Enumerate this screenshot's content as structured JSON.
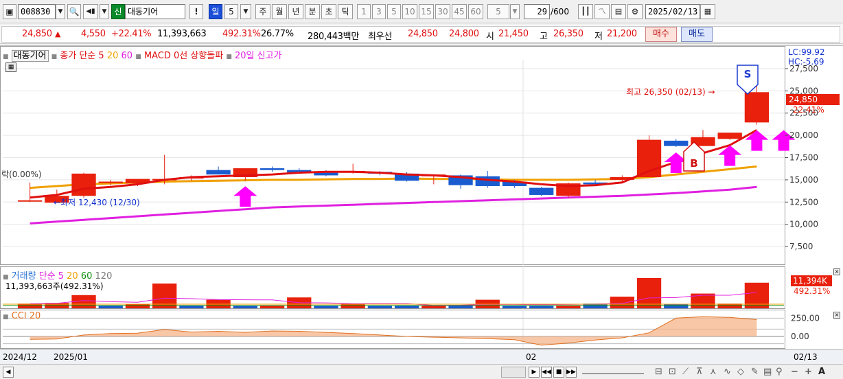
{
  "toolbar": {
    "stock_code": "008830",
    "credit_badge": "신",
    "stock_name": "대동기어",
    "alert": "!",
    "period_day": "일",
    "period_num": "5",
    "period_week": "주",
    "period_month": "월",
    "period_year": "년",
    "period_minute": "분",
    "period_sec": "초",
    "period_tick": "틱",
    "interval_1": "1",
    "interval_3": "3",
    "interval_5": "5",
    "interval_10": "10",
    "interval_15": "15",
    "interval_30": "30",
    "interval_45": "45",
    "interval_60": "60",
    "interval_select": "5",
    "bar_count": "29",
    "bar_total": "/600",
    "date": "2025/02/13"
  },
  "quote": {
    "price": "24,850",
    "change_arrow": "▲",
    "change": "4,550",
    "change_pct": "+22.41%",
    "volume": "11,393,663",
    "volume_ratio": "492.31%",
    "turnover": "26.77%",
    "trade_value": "280,443백만",
    "best_label": "최우선",
    "best_ask": "24,850",
    "best_bid": "24,800",
    "open_label": "시",
    "open": "21,450",
    "high_label": "고",
    "high": "26,350",
    "low_label": "저",
    "low": "21,200",
    "buy_button": "매수",
    "sell_button": "매도"
  },
  "price_pane": {
    "name_tag": "대동기어",
    "legend_close": "종가 단순 5",
    "legend_20": "20",
    "legend_60": "60",
    "legend_macd": "MACD 0선 상향돌파",
    "legend_high20": "20일 신고가",
    "lc": "LC:99.92",
    "hc": "HC:-5.69",
    "current_price_tag": "24,850",
    "current_pct_tag": "22.41%",
    "high_note": "최고 26,350 (02/13) →",
    "low_note": "←최저 12,430 (12/30)",
    "cut_label": "락(0.00%)",
    "signal_s": "S",
    "signal_b": "B",
    "colors": {
      "up": "#e8200c",
      "down": "#1a5ccf",
      "ma5": "#e01010",
      "ma20": "#f0a000",
      "ma60": "#e020e0",
      "arrow": "#ff00ff"
    }
  },
  "volume_pane": {
    "legend_name": "거래량",
    "legend_simple": "단순 5",
    "legend_20": "20",
    "legend_60": "60",
    "legend_120": "120",
    "value_line": "11,393,663주(492.31%)",
    "tag_value": "11,394K",
    "tag_pct": "492.31%"
  },
  "cci_pane": {
    "legend": "CCI 20"
  },
  "x_axis": {
    "start": "2024/12",
    "jan": "2025/01",
    "feb": "02",
    "end": "02/13"
  },
  "chart_data": {
    "type": "candlestick",
    "y_ticks": [
      "27,500",
      "25,000",
      "22,500",
      "20,000",
      "17,500",
      "15,000",
      "12,500",
      "10,000",
      "7,500"
    ],
    "y_range": [
      5500,
      28500
    ],
    "candles": [
      {
        "o": 12700,
        "h": 14700,
        "l": 12500,
        "c": 12700
      },
      {
        "o": 12430,
        "h": 13900,
        "l": 12430,
        "c": 13200
      },
      {
        "o": 13200,
        "h": 15800,
        "l": 13000,
        "c": 15700
      },
      {
        "o": 14700,
        "h": 15000,
        "l": 14400,
        "c": 14800
      },
      {
        "o": 14600,
        "h": 15000,
        "l": 14300,
        "c": 15100
      },
      {
        "o": 15100,
        "h": 17800,
        "l": 14500,
        "c": 15100
      },
      {
        "o": 15200,
        "h": 15500,
        "l": 14900,
        "c": 15300
      },
      {
        "o": 16100,
        "h": 16500,
        "l": 15600,
        "c": 15600
      },
      {
        "o": 15300,
        "h": 16200,
        "l": 14900,
        "c": 16300
      },
      {
        "o": 16300,
        "h": 16500,
        "l": 15900,
        "c": 16100
      },
      {
        "o": 16100,
        "h": 16300,
        "l": 15700,
        "c": 15800
      },
      {
        "o": 15800,
        "h": 16100,
        "l": 15400,
        "c": 15500
      },
      {
        "o": 15800,
        "h": 16800,
        "l": 15700,
        "c": 16000
      },
      {
        "o": 15900,
        "h": 16000,
        "l": 15500,
        "c": 15700
      },
      {
        "o": 15700,
        "h": 15900,
        "l": 14800,
        "c": 14900
      },
      {
        "o": 15400,
        "h": 15600,
        "l": 14500,
        "c": 15600
      },
      {
        "o": 15500,
        "h": 15600,
        "l": 14000,
        "c": 14400
      },
      {
        "o": 15400,
        "h": 16000,
        "l": 14100,
        "c": 14300
      },
      {
        "o": 14800,
        "h": 15000,
        "l": 14100,
        "c": 14300
      },
      {
        "o": 14100,
        "h": 14200,
        "l": 13200,
        "c": 13300
      },
      {
        "o": 13200,
        "h": 14700,
        "l": 13000,
        "c": 14600
      },
      {
        "o": 14700,
        "h": 15000,
        "l": 14300,
        "c": 14500
      },
      {
        "o": 15000,
        "h": 15500,
        "l": 14700,
        "c": 15300
      },
      {
        "o": 15300,
        "h": 20000,
        "l": 15300,
        "c": 19500
      },
      {
        "o": 19400,
        "h": 19600,
        "l": 18700,
        "c": 18800
      },
      {
        "o": 18800,
        "h": 20600,
        "l": 18800,
        "c": 19800
      },
      {
        "o": 19600,
        "h": 20300,
        "l": 19500,
        "c": 20300
      },
      {
        "o": 21450,
        "h": 26350,
        "l": 21200,
        "c": 24850
      }
    ],
    "ma5": [
      13000,
      13300,
      14000,
      14200,
      14500,
      15000,
      15300,
      15400,
      15500,
      15600,
      15800,
      15900,
      15900,
      15800,
      15600,
      15500,
      15300,
      15000,
      14800,
      14500,
      14300,
      14400,
      14700,
      16000,
      17000,
      18000,
      18900,
      20600
    ],
    "ma20": [
      14100,
      14300,
      14500,
      14600,
      14700,
      14800,
      14850,
      14900,
      14950,
      15000,
      15000,
      15050,
      15100,
      15100,
      15150,
      15100,
      15100,
      15050,
      15000,
      15000,
      15000,
      15050,
      15100,
      15300,
      15600,
      15900,
      16200,
      16500
    ],
    "ma60": [
      10100,
      10300,
      10500,
      10700,
      10900,
      11100,
      11300,
      11500,
      11700,
      11900,
      12000,
      12100,
      12200,
      12300,
      12400,
      12500,
      12600,
      12700,
      12800,
      12900,
      13000,
      13100,
      13200,
      13350,
      13500,
      13700,
      13900,
      14200
    ],
    "arrow_indices": [
      8,
      24,
      26,
      27,
      28
    ],
    "volume": [
      600,
      700,
      1700,
      400,
      500,
      3200,
      400,
      1100,
      300,
      400,
      1400,
      300,
      600,
      300,
      400,
      300,
      400,
      1100,
      300,
      300,
      400,
      600,
      1500,
      3900,
      500,
      1900,
      600,
      3300
    ],
    "volume_up": [
      true,
      true,
      true,
      false,
      true,
      true,
      false,
      true,
      false,
      true,
      true,
      false,
      true,
      false,
      false,
      true,
      false,
      true,
      false,
      false,
      true,
      false,
      true,
      true,
      false,
      true,
      true,
      true
    ],
    "cci": [
      -40,
      -35,
      20,
      40,
      45,
      95,
      60,
      70,
      55,
      75,
      70,
      55,
      40,
      20,
      0,
      -10,
      -20,
      -30,
      -45,
      -120,
      -90,
      -50,
      -20,
      50,
      250,
      270,
      260,
      230
    ]
  }
}
